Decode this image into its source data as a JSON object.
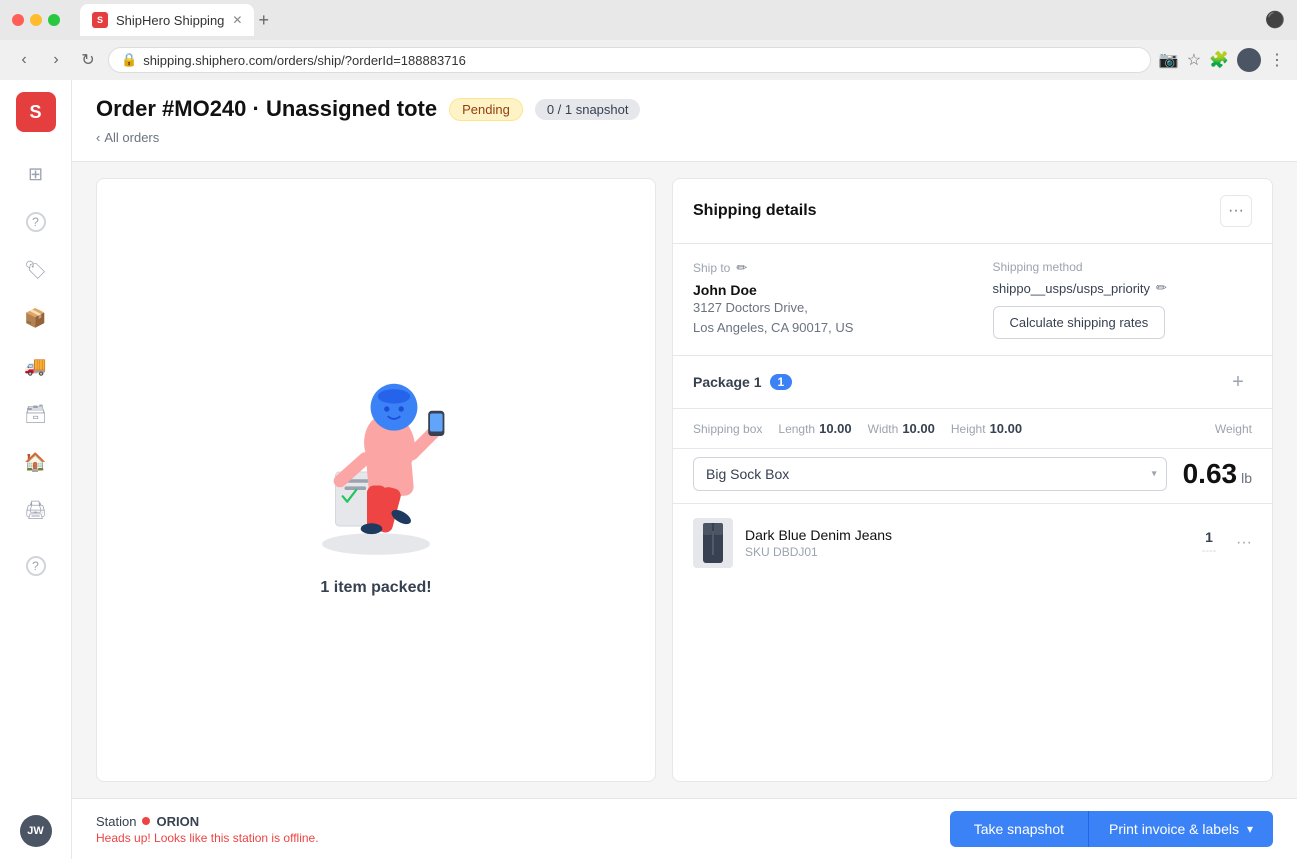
{
  "browser": {
    "tab_title": "ShipHero Shipping",
    "tab_favicon": "S",
    "url": "shipping.shiphero.com/orders/ship/?orderId=188883716",
    "new_tab_label": "+"
  },
  "header": {
    "order_title": "Order #MO240 · Unassigned tote",
    "status_badge": "Pending",
    "snapshot_badge": "0 / 1 snapshot",
    "back_label": "All orders"
  },
  "sidebar": {
    "logo": "S",
    "avatar_initials": "JW",
    "items": [
      {
        "icon": "⊞",
        "name": "dashboard"
      },
      {
        "icon": "?",
        "name": "help"
      },
      {
        "icon": "🏷",
        "name": "tags"
      },
      {
        "icon": "📦",
        "name": "packages"
      },
      {
        "icon": "🚚",
        "name": "shipping"
      },
      {
        "icon": "🗃",
        "name": "inventory"
      },
      {
        "icon": "🏠",
        "name": "home"
      },
      {
        "icon": "🖨",
        "name": "print"
      },
      {
        "icon": "?",
        "name": "support"
      }
    ]
  },
  "left_panel": {
    "packed_text": "1 item packed!"
  },
  "shipping_details": {
    "title": "Shipping details",
    "more_button_label": "···",
    "ship_to_label": "Ship to",
    "recipient_name": "John Doe",
    "address_line1": "3127 Doctors Drive,",
    "address_line2": "Los Angeles, CA 90017, US",
    "shipping_method_label": "Shipping method",
    "shipping_method_value": "shippo__usps/usps_priority",
    "calc_rates_btn_label": "Calculate shipping rates"
  },
  "package": {
    "title": "Package 1",
    "badge": "1",
    "shipping_box_label": "Shipping box",
    "length_label": "Length",
    "length_value": "10.00",
    "width_label": "Width",
    "width_value": "10.00",
    "height_label": "Height",
    "height_value": "10.00",
    "weight_label": "Weight",
    "weight_value": "0.63",
    "weight_unit": "lb",
    "box_name": "Big Sock Box"
  },
  "product": {
    "name": "Dark Blue Denim Jeans",
    "sku_label": "SKU",
    "sku_value": "DBDJ01",
    "quantity": "1",
    "dashes": "----"
  },
  "footer": {
    "station_label": "Station",
    "station_name": "ORION",
    "station_warning": "Heads up! Looks like this station is offline.",
    "take_snapshot_label": "Take snapshot",
    "print_invoice_label": "Print invoice & labels"
  }
}
